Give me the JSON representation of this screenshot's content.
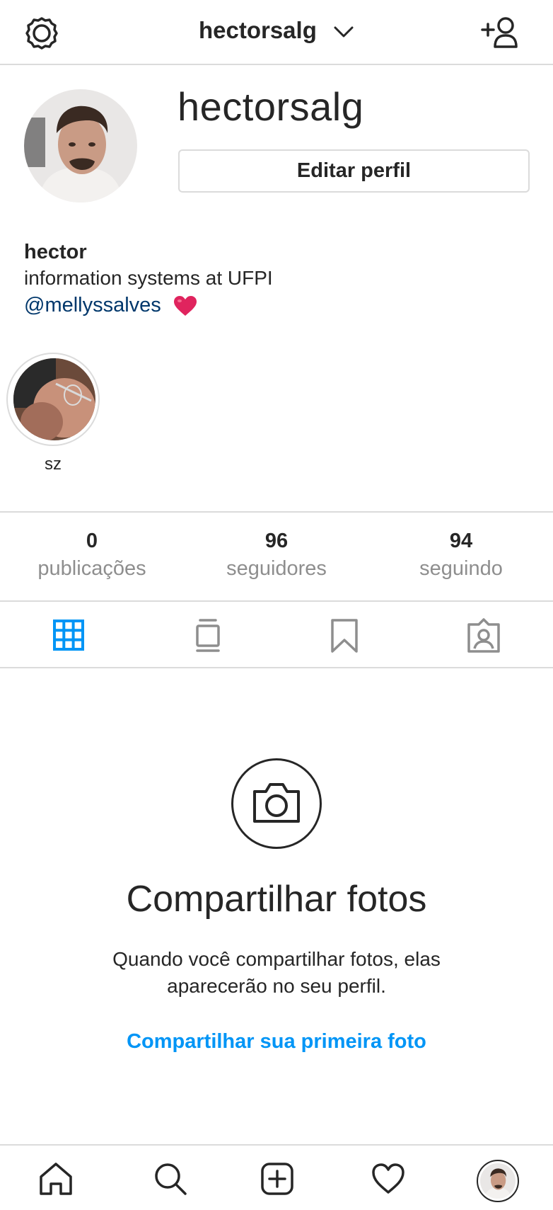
{
  "header": {
    "username": "hectorsalg",
    "settings_icon": "gear-icon",
    "dropdown_icon": "chevron-down-icon",
    "add_user_icon": "add-user-icon"
  },
  "profile": {
    "username": "hectorsalg",
    "edit_button": "Editar perfil",
    "name": "hector",
    "bio": "information systems at UFPI",
    "mention": "@mellyssalves",
    "mention_emoji": "heart-emoji"
  },
  "highlights": [
    {
      "label": "sz"
    }
  ],
  "stats": [
    {
      "count": "0",
      "label": "publicações"
    },
    {
      "count": "96",
      "label": "seguidores"
    },
    {
      "count": "94",
      "label": "seguindo"
    }
  ],
  "tabs": [
    {
      "icon": "grid-icon",
      "active": true
    },
    {
      "icon": "feed-icon",
      "active": false
    },
    {
      "icon": "bookmark-icon",
      "active": false
    },
    {
      "icon": "tagged-icon",
      "active": false
    }
  ],
  "empty_state": {
    "icon": "camera-icon",
    "title": "Compartilhar fotos",
    "description": "Quando você compartilhar fotos, elas aparecerão no seu perfil.",
    "link": "Compartilhar sua primeira foto"
  },
  "bottom_nav": [
    {
      "icon": "home-icon"
    },
    {
      "icon": "search-icon"
    },
    {
      "icon": "new-post-icon"
    },
    {
      "icon": "heart-icon"
    },
    {
      "icon": "profile-avatar"
    }
  ],
  "colors": {
    "accent": "#0095f6",
    "mention": "#00376b",
    "text": "#262626",
    "secondary": "#8e8e8e",
    "divider": "#dbdbdb"
  }
}
